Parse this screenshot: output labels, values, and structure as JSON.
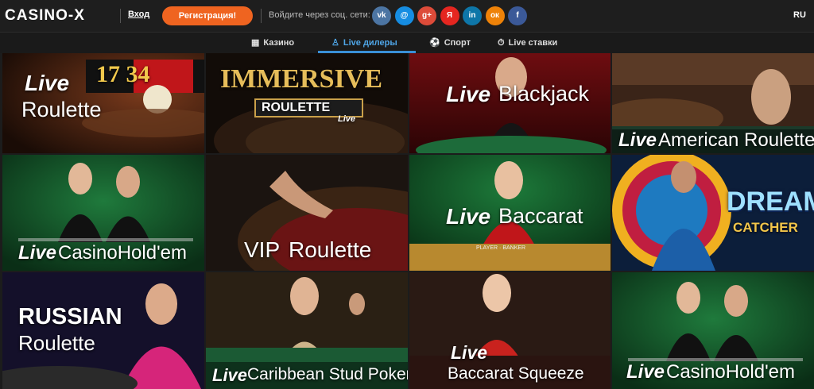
{
  "header": {
    "logo": "CASINO-X",
    "login_label": "Вход",
    "register_label": "Регистрация!",
    "social_label": "Войдите через соц. сети:",
    "social_icons": [
      {
        "name": "vk-icon",
        "glyph": "vk",
        "color": "#4c75a3"
      },
      {
        "name": "mailru-icon",
        "glyph": "@",
        "color": "#168de2"
      },
      {
        "name": "googleplus-icon",
        "glyph": "g+",
        "color": "#dd4b39"
      },
      {
        "name": "yandex-icon",
        "glyph": "Я",
        "color": "#e52620"
      },
      {
        "name": "linkedin-icon",
        "glyph": "in",
        "color": "#0e76a8"
      },
      {
        "name": "odnoklassniki-icon",
        "glyph": "ок",
        "color": "#ee8208"
      },
      {
        "name": "facebook-icon",
        "glyph": "f",
        "color": "#3b5998"
      }
    ],
    "lang": "RU"
  },
  "nav": {
    "items": [
      {
        "label": "Казино",
        "icon": "slot-icon",
        "glyph": "▦",
        "active": false
      },
      {
        "label": "Live дилеры",
        "icon": "dealer-icon",
        "glyph": "♙",
        "active": true
      },
      {
        "label": "Спорт",
        "icon": "ball-icon",
        "glyph": "⚽",
        "active": false
      },
      {
        "label": "Live ставки",
        "icon": "stopwatch-icon",
        "glyph": "⏱",
        "active": false
      }
    ]
  },
  "games": [
    {
      "live": "Live",
      "title": "Roulette"
    },
    {
      "live": "IMMERSIVE",
      "title": "ROULETTE",
      "sub": "Live"
    },
    {
      "live": "Live",
      "title": "Blackjack"
    },
    {
      "live": "Live",
      "title": "American Roulette"
    },
    {
      "live": "Live",
      "title": "CasinoHold'em"
    },
    {
      "live": "VIP",
      "title": "Roulette"
    },
    {
      "live": "Live",
      "title": "Baccarat"
    },
    {
      "live": "DREAM",
      "title": "CATCHER"
    },
    {
      "live": "RUSSIAN",
      "title": "Roulette"
    },
    {
      "live": "Live",
      "title": "Caribbean Stud Poker"
    },
    {
      "live": "Live",
      "title": "Baccarat Squeeze"
    },
    {
      "live": "Live",
      "title": "CasinoHold'em"
    }
  ],
  "art_text": {
    "wheel_numbers": "17 34",
    "table_labels": "PLAYER · BANKER"
  },
  "colors": {
    "accent": "#ef6420",
    "active_nav": "#4fa6e8",
    "header_bg": "#1e1e1e"
  }
}
